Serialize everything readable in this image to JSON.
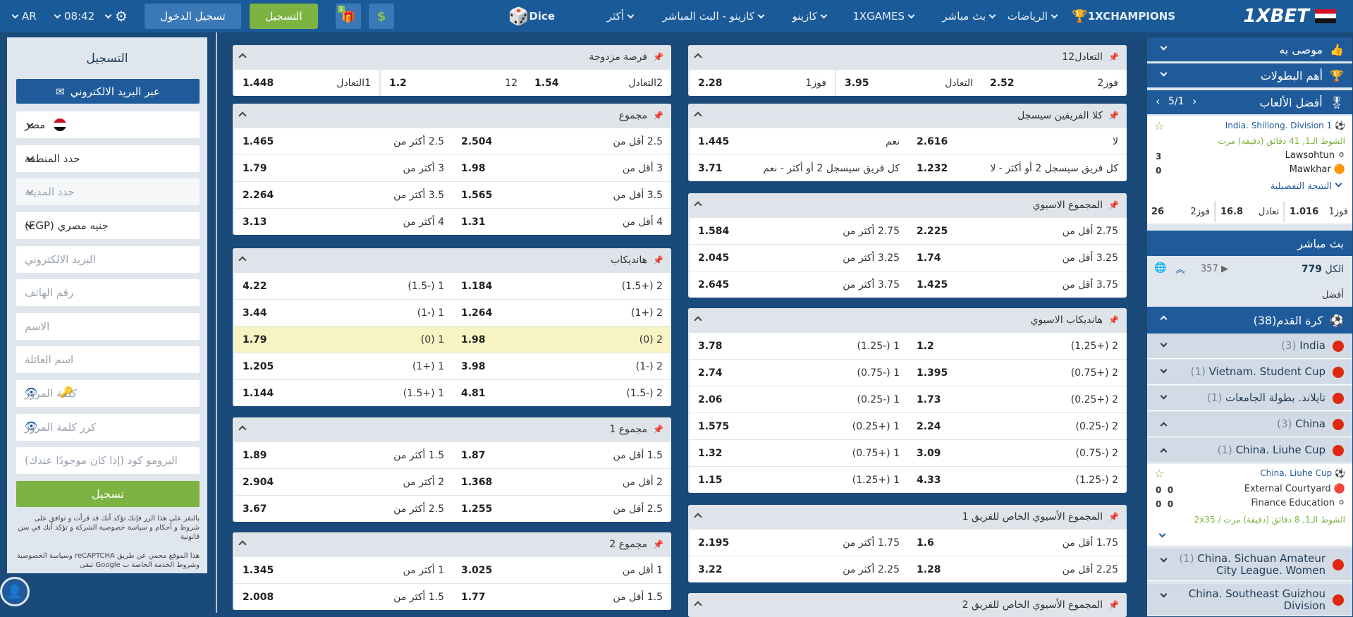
{
  "topbar": {
    "brand": "1XBET",
    "champions": "1XCHAMPIONS",
    "nav": [
      "الرياضات",
      "بث مباشر",
      "1XGAMES",
      "كازينو",
      "كازينو - البث المباشر",
      "أكثر"
    ],
    "dice": "Dice",
    "register_btn": "التسجيل",
    "login_btn": "تسجيل الدخول",
    "time": "08:42",
    "lang": "AR",
    "gift_count": "1"
  },
  "center": {
    "left_col": [
      {
        "title": "فرصة مزدوجة",
        "rows": [
          [
            [
              "1التعادل",
              "1.448"
            ],
            [
              "12",
              "1.2"
            ],
            [
              "2التعادل",
              "1.54"
            ]
          ]
        ]
      },
      {
        "title": "مجموع",
        "rows": [
          [
            [
              "2.5 أكثر من",
              "1.465"
            ],
            [
              "2.5 أقل من",
              "2.504"
            ]
          ],
          [
            [
              "3 أكثر من",
              "1.79"
            ],
            [
              "3 أقل من",
              "1.98"
            ]
          ],
          [
            [
              "3.5 أكثر من",
              "2.264"
            ],
            [
              "3.5 أقل من",
              "1.565"
            ]
          ],
          [
            [
              "4 أكثر من",
              "3.13"
            ],
            [
              "4 أقل من",
              "1.31"
            ]
          ]
        ]
      },
      {
        "title": "هانديكاب",
        "rows": [
          [
            [
              "1 (-1.5)",
              "4.22"
            ],
            [
              "2 (+1.5)",
              "1.184"
            ]
          ],
          [
            [
              "1 (-1)",
              "3.44"
            ],
            [
              "2 (+1)",
              "1.264"
            ]
          ],
          [
            [
              "1 (0)",
              "1.79"
            ],
            [
              "2 (0)",
              "1.98"
            ]
          ],
          [
            [
              "1 (+1)",
              "1.205"
            ],
            [
              "2 (-1)",
              "3.98"
            ]
          ],
          [
            [
              "1 (+1.5)",
              "1.144"
            ],
            [
              "2 (-1.5)",
              "4.81"
            ]
          ]
        ]
      },
      {
        "title": "مجموع 1",
        "rows": [
          [
            [
              "1.5 أكثر من",
              "1.89"
            ],
            [
              "1.5 أقل من",
              "1.87"
            ]
          ],
          [
            [
              "2 أكثر من",
              "2.904"
            ],
            [
              "2 أقل من",
              "1.368"
            ]
          ],
          [
            [
              "2.5 أكثر من",
              "3.67"
            ],
            [
              "2.5 أقل من",
              "1.255"
            ]
          ]
        ]
      },
      {
        "title": "مجموع 2",
        "rows": [
          [
            [
              "1 أكثر من",
              "1.345"
            ],
            [
              "1 أقل من",
              "3.025"
            ]
          ],
          [
            [
              "1.5 أكثر من",
              "2.008"
            ],
            [
              "1.5 أقل من",
              "1.77"
            ]
          ]
        ]
      }
    ],
    "right_col": [
      {
        "title": "1التعادل2",
        "rows": [
          [
            [
              "فوز1",
              "2.28"
            ],
            [
              "التعادل",
              "3.95"
            ],
            [
              "فوز2",
              "2.52"
            ]
          ]
        ]
      },
      {
        "title": "كلا الفريقين سيسجل",
        "rows": [
          [
            [
              "نعم",
              "1.445"
            ],
            [
              "لا",
              "2.616"
            ]
          ],
          [
            [
              "كل فريق سيسجل 2 أو أكثر - نعم",
              "3.71"
            ],
            [
              "كل فريق سيسجل 2 أو أكثر - لا",
              "1.232"
            ]
          ]
        ]
      },
      {
        "title": "المجموع الاسيوي",
        "rows": [
          [
            [
              "2.75 أكثر من",
              "1.584"
            ],
            [
              "2.75 أقل من",
              "2.225"
            ]
          ],
          [
            [
              "3.25 أكثر من",
              "2.045"
            ],
            [
              "3.25 أقل من",
              "1.74"
            ]
          ],
          [
            [
              "3.75 أكثر من",
              "2.645"
            ],
            [
              "3.75 أقل من",
              "1.425"
            ]
          ]
        ]
      },
      {
        "title": "هانديكاب الاسيوي",
        "rows": [
          [
            [
              "1 (-1.25)",
              "3.78"
            ],
            [
              "2 (+1.25)",
              "1.2"
            ]
          ],
          [
            [
              "1 (-0.75)",
              "2.74"
            ],
            [
              "2 (+0.75)",
              "1.395"
            ]
          ],
          [
            [
              "1 (-0.25)",
              "2.06"
            ],
            [
              "2 (+0.25)",
              "1.73"
            ]
          ],
          [
            [
              "1 (+0.25)",
              "1.575"
            ],
            [
              "2 (-0.25)",
              "2.24"
            ]
          ],
          [
            [
              "1 (+0.75)",
              "1.32"
            ],
            [
              "2 (-0.75)",
              "3.09"
            ]
          ],
          [
            [
              "1 (+1.25)",
              "1.15"
            ],
            [
              "2 (-1.25)",
              "4.33"
            ]
          ]
        ]
      },
      {
        "title": "المجموع الأسيوي الخاص للفريق 1",
        "rows": [
          [
            [
              "1.75 أكثر من",
              "2.195"
            ],
            [
              "1.75 أقل من",
              "1.6"
            ]
          ],
          [
            [
              "2.25 أكثر من",
              "3.22"
            ],
            [
              "2.25 أقل من",
              "1.28"
            ]
          ]
        ]
      },
      {
        "title": "المجموع الأسيوي الخاص للفريق 2",
        "rows": []
      }
    ]
  },
  "right_sidebar": {
    "recommended": "موصى به",
    "top_leagues": "أهم البطولات",
    "best_games": "أفضل الألعاب",
    "pager": "5/1",
    "game": {
      "league": "India. Shillong. Division 1",
      "time_info": "الشوط الـ1, 41 دقائق (دقيقة) مرت",
      "team1": "Lawsohtun",
      "score1": "3",
      "team2": "Mawkhar",
      "score2": "0",
      "details": "النتيجة التفصيلية",
      "odds": [
        [
          "فوز1",
          "1.016"
        ],
        [
          "تعادل",
          "16.8"
        ],
        [
          "فوز2",
          "26"
        ]
      ]
    },
    "live": "بث مباشر",
    "all_label": "الكل",
    "all_count": "779",
    "video_count": "357",
    "best": "أفضل",
    "football": "كرة القدم",
    "football_count": "(38)",
    "leagues": [
      {
        "name": "India",
        "count": "(3)"
      },
      {
        "name": "Vietnam. Student Cup",
        "count": "(1)"
      },
      {
        "name": "تايلاند. بطولة الجامعات",
        "count": "(1)"
      },
      {
        "name": "China",
        "count": "(3)"
      },
      {
        "name": "China. Liuhe Cup",
        "count": "(1)"
      }
    ],
    "match2": {
      "league": "China. Liuhe Cup",
      "team1": "External Courtyard",
      "s1a": "0",
      "s1b": "0",
      "team2": "Finance Education",
      "s2a": "0",
      "s2b": "0",
      "time_info": "الشوط الـ1, 8 دقائق (دقيقة) مرت / 2x35"
    },
    "league_more": [
      {
        "name": "China. Sichuan Amateur City League. Women",
        "count": "(1)"
      },
      {
        "name": "China. Southeast Guizhou Division",
        "count": ""
      }
    ]
  },
  "left_sidebar": {
    "title": "التسجيل",
    "email_btn": "عبر البريد الالكتروني",
    "country": "مصر",
    "region": "حدد المنطقة",
    "city": "حدد المدينة",
    "currency": "جنيه مصري (EGP)",
    "email_ph": "البريد الالكتروني",
    "phone_ph": "رقم الهاتف",
    "name_ph": "الاسم",
    "surname_ph": "اسم العائلة",
    "password_ph": "كلمة المرور",
    "password2_ph": "كرر كلمة المرور",
    "promo_ph": "البرومو كود (إذا كان موجودًا عندك)",
    "submit": "تسجيل",
    "terms": "بالنقر على هذا الزر فإنك تؤكد أنك قد قرأت و توافق على شروط و أحكام و سياسة خصوصية الشركة و تؤكد أنك في سن قانونية",
    "captcha": "هذا الموقع محمي عن طريق reCAPTCHA وسياسة الخصوصية وشروط الخدمة الخاصة ب Google تبقى"
  }
}
